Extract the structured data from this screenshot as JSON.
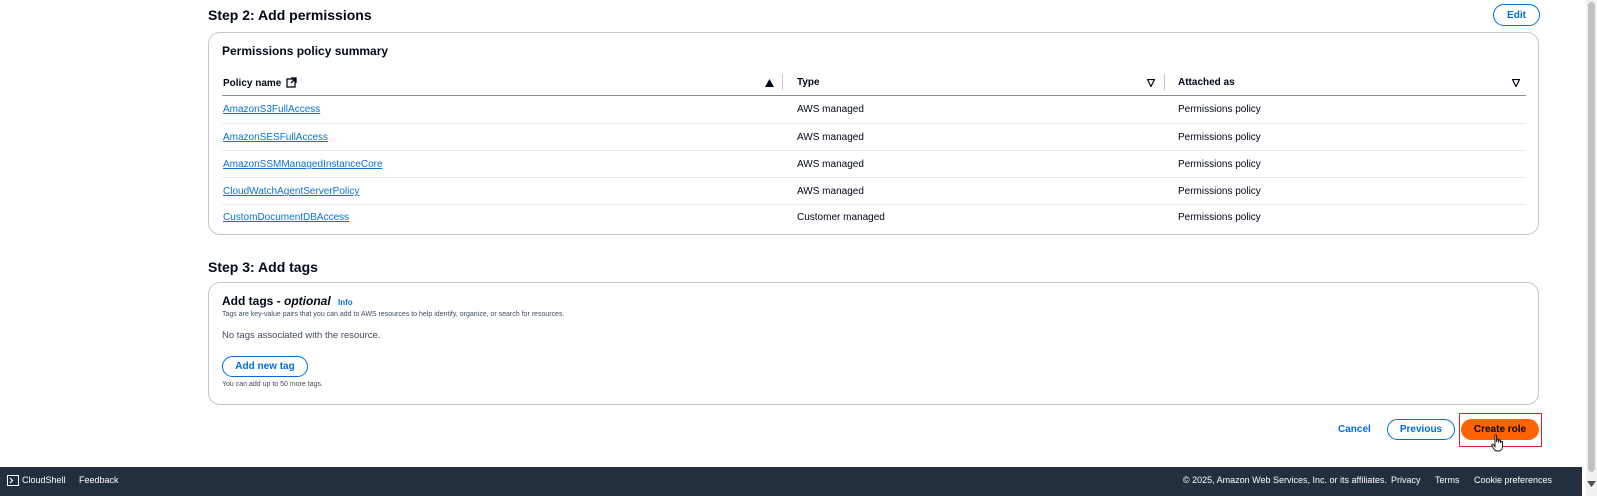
{
  "step2": {
    "title": "Step 2: Add permissions",
    "edit_label": "Edit",
    "card_title": "Permissions policy summary",
    "columns": [
      "Policy name",
      "Type",
      "Attached as"
    ],
    "rows": [
      {
        "name": "AmazonS3FullAccess",
        "type": "AWS managed",
        "attached": "Permissions policy"
      },
      {
        "name": "AmazonSESFullAccess",
        "type": "AWS managed",
        "attached": "Permissions policy"
      },
      {
        "name": "AmazonSSMManagedInstanceCore",
        "type": "AWS managed",
        "attached": "Permissions policy"
      },
      {
        "name": "CloudWatchAgentServerPolicy",
        "type": "AWS managed",
        "attached": "Permissions policy"
      },
      {
        "name": "CustomDocumentDBAccess",
        "type": "Customer managed",
        "attached": "Permissions policy"
      }
    ]
  },
  "step3": {
    "title": "Step 3: Add tags",
    "card_title": "Add tags - ",
    "card_title_optional": "optional",
    "info_label": "Info",
    "description": "Tags are key-value pairs that you can add to AWS resources to help identify, organize, or search for resources.",
    "empty_text": "No tags associated with the resource.",
    "add_tag_label": "Add new tag",
    "limit_text": "You can add up to 50 more tags."
  },
  "actions": {
    "cancel": "Cancel",
    "previous": "Previous",
    "create": "Create role"
  },
  "footer": {
    "cloudshell": "CloudShell",
    "feedback": "Feedback",
    "copyright": "© 2025, Amazon Web Services, Inc. or its affiliates.",
    "privacy": "Privacy",
    "terms": "Terms",
    "cookie": "Cookie preferences"
  },
  "colors": {
    "accent": "#0972d3",
    "primary_button": "#ff9900",
    "footer_bg": "#232f3e",
    "highlight_box": "#e02020"
  }
}
